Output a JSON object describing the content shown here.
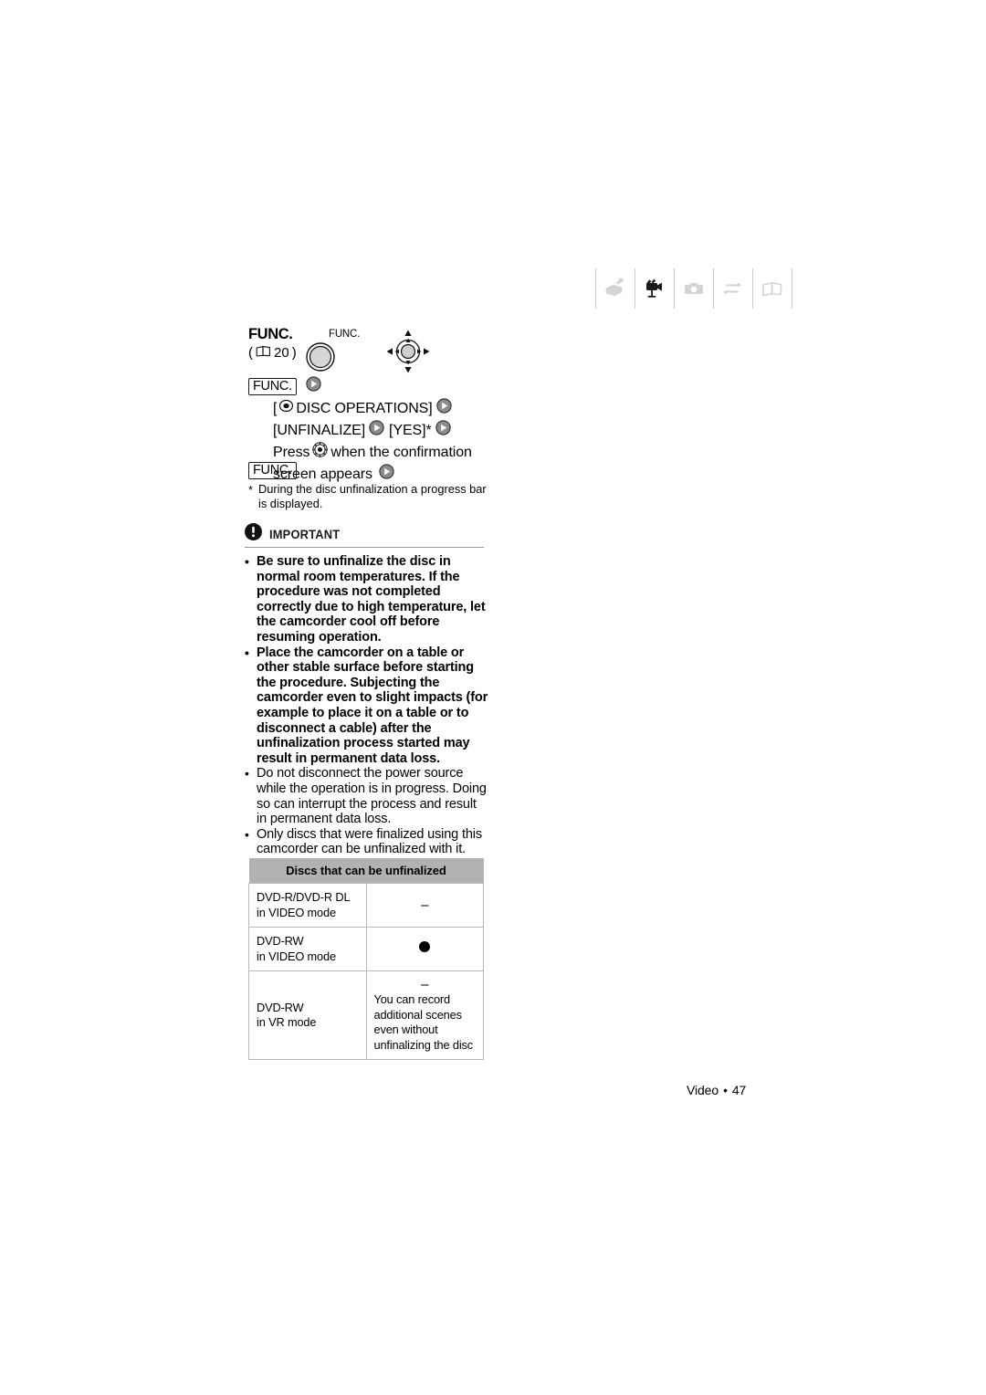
{
  "mode_strip": {
    "icons": [
      {
        "name": "camcorder-icon",
        "state": "inactive"
      },
      {
        "name": "movie-camera-icon",
        "state": "active"
      },
      {
        "name": "photo-camera-icon",
        "state": "inactive"
      },
      {
        "name": "exchange-arrows-icon",
        "state": "inactive"
      },
      {
        "name": "open-book-icon",
        "state": "inactive"
      }
    ],
    "active_color": "#1a1a1a",
    "inactive_color": "#d4d4d4",
    "separator_color": "#c9c9c9"
  },
  "func_header": {
    "title": "FUNC.",
    "page_ref_open": "(",
    "page_ref_number": "20",
    "page_ref_close": ")",
    "book_icon": "book-icon",
    "button_label": "FUNC.",
    "button_icon": "func-button-icon",
    "joystick_icon": "joystick-icon"
  },
  "procedure": {
    "start_chip": "FUNC.",
    "step1": "[",
    "step1_icon": "disc-icon",
    "step1_text": "DISC OPERATIONS]",
    "step2a": "[UNFINALIZE]",
    "step2b": "[YES]*",
    "step3a": "Press",
    "step3_icon": "joystick-press-icon",
    "step3b": "when the confirmation",
    "step3c": "screen appears",
    "end_chip": "FUNC.",
    "arrow_icon": "step-arrow-icon"
  },
  "footnote": {
    "marker": "*",
    "text": "During the disc unfinalization a progress bar is displayed."
  },
  "important": {
    "icon": "exclamation-icon",
    "title": "IMPORTANT",
    "notes": [
      {
        "bullet": "•",
        "bold": true,
        "text": "Be sure to unfinalize the disc in normal room temperatures. If the procedure was not completed correctly due to high temperature, let the camcorder cool off before resuming operation."
      },
      {
        "bullet": "•",
        "bold": true,
        "text": "Place the camcorder on a table or other stable surface before starting the procedure. Subjecting the camcorder even to slight impacts (for example to place it on a table or to disconnect a cable) after the unfinalization process started may result in permanent data loss."
      },
      {
        "bullet": "•",
        "bold": false,
        "text": "Do not disconnect the power source while the operation is in progress. Doing so can interrupt the process and result in permanent data loss."
      },
      {
        "bullet": "•",
        "bold": false,
        "text": "Only discs that were finalized using this camcorder can be unfinalized with it."
      }
    ]
  },
  "disc_table": {
    "header": "Discs that can be unfinalized",
    "header_bg": "#b2b2b2",
    "rows": [
      {
        "label_line1": "DVD-R/DVD-R DL",
        "label_line2": "in VIDEO mode",
        "value_symbol": "–",
        "value_note": ""
      },
      {
        "label_line1": "DVD-RW",
        "label_line2": "in VIDEO mode",
        "value_symbol": "dot",
        "value_note": ""
      },
      {
        "label_line1": "DVD-RW",
        "label_line2": "in VR mode",
        "value_symbol": "–",
        "value_note": "You can record additional scenes even without unfinalizing the disc"
      }
    ]
  },
  "footer": {
    "section": "Video",
    "separator": "•",
    "page_number": "47"
  }
}
